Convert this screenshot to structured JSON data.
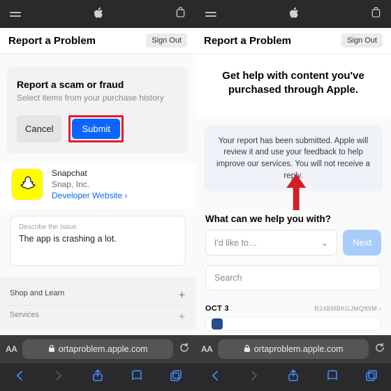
{
  "topbar": {},
  "titlebar": {
    "title": "Report a Problem",
    "signout": "Sign Out"
  },
  "left": {
    "card": {
      "title": "Report a scam or fraud",
      "subtitle": "Select items from your purchase history",
      "cancel": "Cancel",
      "submit": "Submit"
    },
    "app": {
      "name": "Snapchat",
      "vendor": "Snap, Inc.",
      "link": "Developer Website ›"
    },
    "issue": {
      "label": "Describe the Issue",
      "value": "The app is crashing a lot."
    },
    "footer": {
      "row1": "Shop and Learn",
      "row2": "Services"
    }
  },
  "right": {
    "headline": "Get help with content you've purchased through Apple.",
    "info": "Your report has been submitted. Apple will review it and use your feedback to help improve our services. You will not receive a reply.",
    "prompt": "What can we help you with?",
    "select_placeholder": "I'd like to…",
    "next": "Next",
    "search_placeholder": "Search",
    "date": "OCT 3",
    "order": "R24BMBKGJMQ89M ›"
  },
  "safari": {
    "aa": "AA",
    "url": "ortaproblem.apple.com"
  }
}
